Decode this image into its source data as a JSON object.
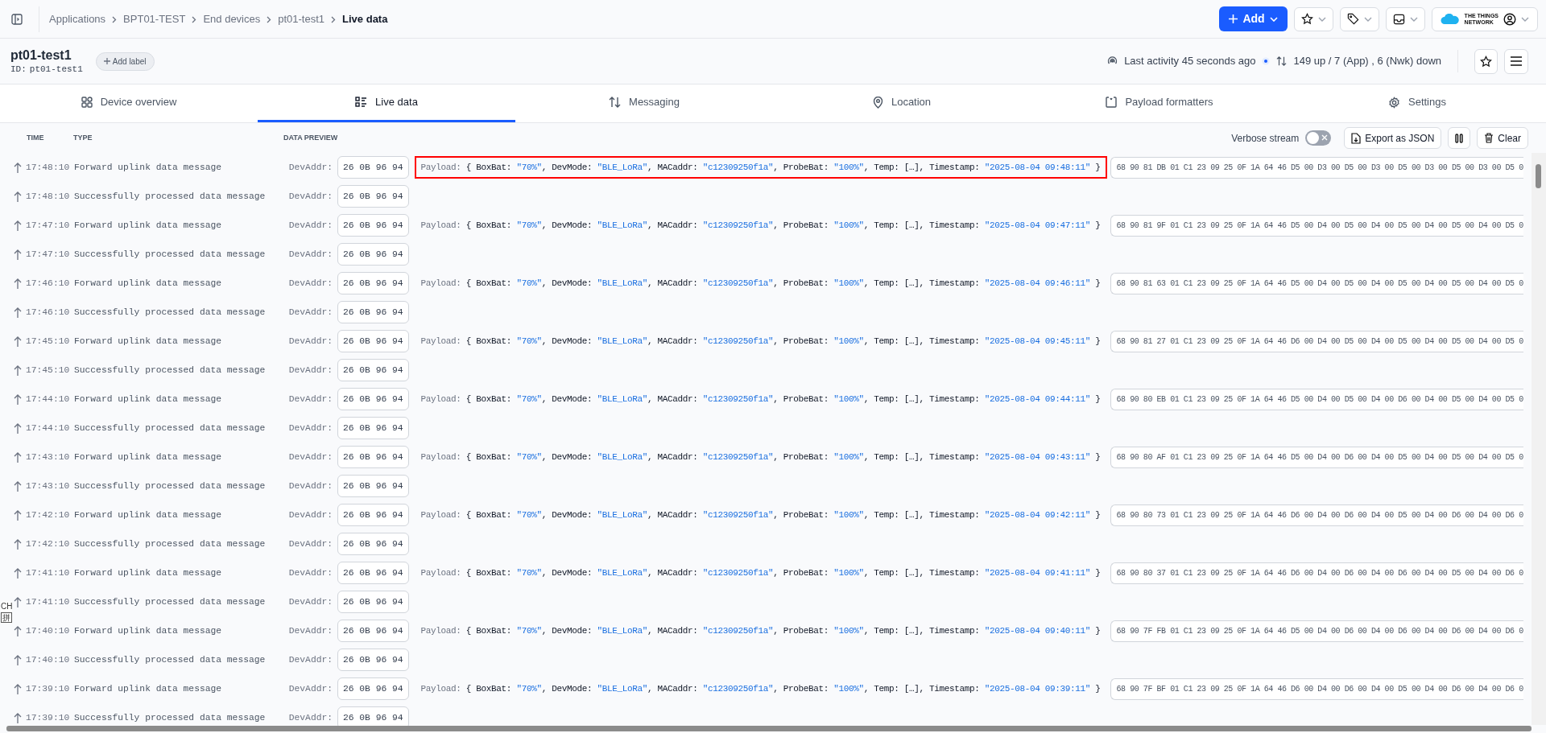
{
  "breadcrumbs": [
    {
      "label": "Applications",
      "current": false
    },
    {
      "label": "BPT01-TEST",
      "current": false
    },
    {
      "label": "End devices",
      "current": false
    },
    {
      "label": "pt01-test1",
      "current": false
    },
    {
      "label": "Live data",
      "current": true
    }
  ],
  "topbar": {
    "add_button": "Add",
    "logo_lines": [
      "THE THINGS",
      "NETWORK"
    ]
  },
  "device": {
    "name": "pt01-test1",
    "id_label": "ID:",
    "id": "pt01-test1",
    "add_label": "Add label",
    "last_activity": "Last activity 45 seconds ago",
    "traffic": "149 up / 7 (App) , 6 (Nwk) down"
  },
  "tabs": [
    {
      "label": "Device overview",
      "selected": false
    },
    {
      "label": "Live data",
      "selected": true
    },
    {
      "label": "Messaging",
      "selected": false
    },
    {
      "label": "Location",
      "selected": false
    },
    {
      "label": "Payload formatters",
      "selected": false
    },
    {
      "label": "Settings",
      "selected": false
    }
  ],
  "table": {
    "columns": [
      "TIME",
      "TYPE",
      "DATA PREVIEW"
    ],
    "verbose_stream": {
      "label": "Verbose stream",
      "on": false
    },
    "export_button": "Export as JSON",
    "clear_button": "Clear",
    "rows": [
      {
        "kind": "uplink",
        "time": "17:48:10",
        "type": "Forward uplink data message",
        "devaddr_label": "DevAddr:",
        "devaddr": "26 0B 96 94",
        "highlighted": true,
        "payload_label": "Payload:",
        "payload": "{ BoxBat: \"70%\", DevMode: \"BLE_LoRa\", MACaddr: \"c12309250f1a\", ProbeBat: \"100%\", Temp: […], Timestamp: \"2025-08-04 09:48:11\" }",
        "raw": "68 90 81 DB 01 C1 23 09 25 0F 1A 64 46 D5 00 D3 00 D5 00 D3 00 D5 00 D3 00 D5 00 D3 00 D5 0"
      },
      {
        "kind": "processed",
        "time": "17:48:10",
        "type": "Successfully processed data message",
        "devaddr_label": "DevAddr:",
        "devaddr": "26 0B 96 94"
      },
      {
        "kind": "uplink",
        "time": "17:47:10",
        "type": "Forward uplink data message",
        "devaddr_label": "DevAddr:",
        "devaddr": "26 0B 96 94",
        "highlighted": false,
        "payload_label": "Payload:",
        "payload": "{ BoxBat: \"70%\", DevMode: \"BLE_LoRa\", MACaddr: \"c12309250f1a\", ProbeBat: \"100%\", Temp: […], Timestamp: \"2025-08-04 09:47:11\" }",
        "raw": "68 90 81 9F 01 C1 23 09 25 0F 1A 64 46 D5 00 D4 00 D5 00 D4 00 D5 00 D4 00 D5 00 D4 00 D5 0"
      },
      {
        "kind": "processed",
        "time": "17:47:10",
        "type": "Successfully processed data message",
        "devaddr_label": "DevAddr:",
        "devaddr": "26 0B 96 94"
      },
      {
        "kind": "uplink",
        "time": "17:46:10",
        "type": "Forward uplink data message",
        "devaddr_label": "DevAddr:",
        "devaddr": "26 0B 96 94",
        "highlighted": false,
        "payload_label": "Payload:",
        "payload": "{ BoxBat: \"70%\", DevMode: \"BLE_LoRa\", MACaddr: \"c12309250f1a\", ProbeBat: \"100%\", Temp: […], Timestamp: \"2025-08-04 09:46:11\" }",
        "raw": "68 90 81 63 01 C1 23 09 25 0F 1A 64 46 D5 00 D4 00 D5 00 D4 00 D5 00 D4 00 D5 00 D4 00 D5 0"
      },
      {
        "kind": "processed",
        "time": "17:46:10",
        "type": "Successfully processed data message",
        "devaddr_label": "DevAddr:",
        "devaddr": "26 0B 96 94"
      },
      {
        "kind": "uplink",
        "time": "17:45:10",
        "type": "Forward uplink data message",
        "devaddr_label": "DevAddr:",
        "devaddr": "26 0B 96 94",
        "highlighted": false,
        "payload_label": "Payload:",
        "payload": "{ BoxBat: \"70%\", DevMode: \"BLE_LoRa\", MACaddr: \"c12309250f1a\", ProbeBat: \"100%\", Temp: […], Timestamp: \"2025-08-04 09:45:11\" }",
        "raw": "68 90 81 27 01 C1 23 09 25 0F 1A 64 46 D6 00 D4 00 D5 00 D4 00 D5 00 D4 00 D5 00 D4 00 D5 0"
      },
      {
        "kind": "processed",
        "time": "17:45:10",
        "type": "Successfully processed data message",
        "devaddr_label": "DevAddr:",
        "devaddr": "26 0B 96 94"
      },
      {
        "kind": "uplink",
        "time": "17:44:10",
        "type": "Forward uplink data message",
        "devaddr_label": "DevAddr:",
        "devaddr": "26 0B 96 94",
        "highlighted": false,
        "payload_label": "Payload:",
        "payload": "{ BoxBat: \"70%\", DevMode: \"BLE_LoRa\", MACaddr: \"c12309250f1a\", ProbeBat: \"100%\", Temp: […], Timestamp: \"2025-08-04 09:44:11\" }",
        "raw": "68 90 80 EB 01 C1 23 09 25 0F 1A 64 46 D5 00 D4 00 D5 00 D4 00 D6 00 D4 00 D5 00 D4 00 D5 0"
      },
      {
        "kind": "processed",
        "time": "17:44:10",
        "type": "Successfully processed data message",
        "devaddr_label": "DevAddr:",
        "devaddr": "26 0B 96 94"
      },
      {
        "kind": "uplink",
        "time": "17:43:10",
        "type": "Forward uplink data message",
        "devaddr_label": "DevAddr:",
        "devaddr": "26 0B 96 94",
        "highlighted": false,
        "payload_label": "Payload:",
        "payload": "{ BoxBat: \"70%\", DevMode: \"BLE_LoRa\", MACaddr: \"c12309250f1a\", ProbeBat: \"100%\", Temp: […], Timestamp: \"2025-08-04 09:43:11\" }",
        "raw": "68 90 80 AF 01 C1 23 09 25 0F 1A 64 46 D5 00 D4 00 D6 00 D4 00 D5 00 D4 00 D5 00 D4 00 D5 0"
      },
      {
        "kind": "processed",
        "time": "17:43:10",
        "type": "Successfully processed data message",
        "devaddr_label": "DevAddr:",
        "devaddr": "26 0B 96 94"
      },
      {
        "kind": "uplink",
        "time": "17:42:10",
        "type": "Forward uplink data message",
        "devaddr_label": "DevAddr:",
        "devaddr": "26 0B 96 94",
        "highlighted": false,
        "payload_label": "Payload:",
        "payload": "{ BoxBat: \"70%\", DevMode: \"BLE_LoRa\", MACaddr: \"c12309250f1a\", ProbeBat: \"100%\", Temp: […], Timestamp: \"2025-08-04 09:42:11\" }",
        "raw": "68 90 80 73 01 C1 23 09 25 0F 1A 64 46 D6 00 D4 00 D6 00 D4 00 D5 00 D4 00 D6 00 D4 00 D6 0"
      },
      {
        "kind": "processed",
        "time": "17:42:10",
        "type": "Successfully processed data message",
        "devaddr_label": "DevAddr:",
        "devaddr": "26 0B 96 94"
      },
      {
        "kind": "uplink",
        "time": "17:41:10",
        "type": "Forward uplink data message",
        "devaddr_label": "DevAddr:",
        "devaddr": "26 0B 96 94",
        "highlighted": false,
        "payload_label": "Payload:",
        "payload": "{ BoxBat: \"70%\", DevMode: \"BLE_LoRa\", MACaddr: \"c12309250f1a\", ProbeBat: \"100%\", Temp: […], Timestamp: \"2025-08-04 09:41:11\" }",
        "raw": "68 90 80 37 01 C1 23 09 25 0F 1A 64 46 D6 00 D4 00 D6 00 D4 00 D6 00 D4 00 D5 00 D4 00 D6 0"
      },
      {
        "kind": "processed",
        "time": "17:41:10",
        "type": "Successfully processed data message",
        "devaddr_label": "DevAddr:",
        "devaddr": "26 0B 96 94"
      },
      {
        "kind": "uplink",
        "time": "17:40:10",
        "type": "Forward uplink data message",
        "devaddr_label": "DevAddr:",
        "devaddr": "26 0B 96 94",
        "highlighted": false,
        "payload_label": "Payload:",
        "payload": "{ BoxBat: \"70%\", DevMode: \"BLE_LoRa\", MACaddr: \"c12309250f1a\", ProbeBat: \"100%\", Temp: […], Timestamp: \"2025-08-04 09:40:11\" }",
        "raw": "68 90 7F FB 01 C1 23 09 25 0F 1A 64 46 D5 00 D4 00 D6 00 D4 00 D6 00 D4 00 D6 00 D4 00 D6 0"
      },
      {
        "kind": "processed",
        "time": "17:40:10",
        "type": "Successfully processed data message",
        "devaddr_label": "DevAddr:",
        "devaddr": "26 0B 96 94"
      },
      {
        "kind": "uplink",
        "time": "17:39:10",
        "type": "Forward uplink data message",
        "devaddr_label": "DevAddr:",
        "devaddr": "26 0B 96 94",
        "highlighted": false,
        "payload_label": "Payload:",
        "payload": "{ BoxBat: \"70%\", DevMode: \"BLE_LoRa\", MACaddr: \"c12309250f1a\", ProbeBat: \"100%\", Temp: […], Timestamp: \"2025-08-04 09:39:11\" }",
        "raw": "68 90 7F BF 01 C1 23 09 25 0F 1A 64 46 D6 00 D4 00 D6 00 D4 00 D5 00 D4 00 D6 00 D4 00 D6 0"
      },
      {
        "kind": "processed",
        "time": "17:39:10",
        "type": "Successfully processed data message",
        "devaddr_label": "DevAddr:",
        "devaddr": "26 0B 96 94"
      }
    ]
  },
  "ime_indicator": {
    "language": "CH",
    "mode": "拼"
  }
}
